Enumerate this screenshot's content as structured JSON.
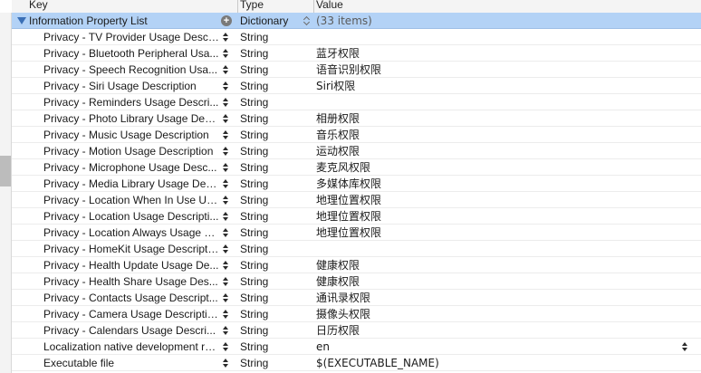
{
  "header": {
    "key_label": "Key",
    "type_label": "Type",
    "value_label": "Value"
  },
  "root": {
    "key": "Information Property List",
    "type": "Dictionary",
    "value": "(33 items)"
  },
  "rows": [
    {
      "key": "Privacy - TV Provider Usage Descr...",
      "type": "String",
      "value": ""
    },
    {
      "key": "Privacy - Bluetooth Peripheral Usa...",
      "type": "String",
      "value": "蓝牙权限"
    },
    {
      "key": "Privacy - Speech Recognition Usa...",
      "type": "String",
      "value": "语音识别权限"
    },
    {
      "key": "Privacy - Siri Usage Description",
      "type": "String",
      "value": "Siri权限"
    },
    {
      "key": "Privacy - Reminders Usage Descri...",
      "type": "String",
      "value": ""
    },
    {
      "key": "Privacy - Photo Library Usage Des...",
      "type": "String",
      "value": "相册权限"
    },
    {
      "key": "Privacy - Music Usage Description",
      "type": "String",
      "value": "音乐权限"
    },
    {
      "key": "Privacy - Motion Usage Description",
      "type": "String",
      "value": "运动权限"
    },
    {
      "key": "Privacy - Microphone Usage Desc...",
      "type": "String",
      "value": "麦克风权限"
    },
    {
      "key": "Privacy - Media Library Usage Des...",
      "type": "String",
      "value": "多媒体库权限"
    },
    {
      "key": "Privacy - Location When In Use Us...",
      "type": "String",
      "value": "地理位置权限"
    },
    {
      "key": "Privacy - Location Usage Descripti...",
      "type": "String",
      "value": "地理位置权限"
    },
    {
      "key": "Privacy - Location Always Usage D...",
      "type": "String",
      "value": "地理位置权限"
    },
    {
      "key": "Privacy - HomeKit Usage Descripti...",
      "type": "String",
      "value": ""
    },
    {
      "key": "Privacy - Health Update Usage De...",
      "type": "String",
      "value": "健康权限"
    },
    {
      "key": "Privacy - Health Share Usage Des...",
      "type": "String",
      "value": "健康权限"
    },
    {
      "key": "Privacy - Contacts Usage Descript...",
      "type": "String",
      "value": "通讯录权限"
    },
    {
      "key": "Privacy - Camera Usage Description",
      "type": "String",
      "value": "摄像头权限"
    },
    {
      "key": "Privacy - Calendars Usage Descri...",
      "type": "String",
      "value": "日历权限"
    },
    {
      "key": "Localization native development re...",
      "type": "String",
      "value": "en",
      "value_stepper": true
    },
    {
      "key": "Executable file",
      "type": "String",
      "value": "$(EXECUTABLE_NAME)"
    }
  ],
  "colors": {
    "selection": "#b3d2f6",
    "header_bg": "#f4f4f4",
    "grid_line": "#ececec"
  },
  "icons": {
    "disclosure": "disclosure-triangle-icon",
    "add": "plus-circle-icon",
    "stepper": "up-down-stepper-icon"
  }
}
